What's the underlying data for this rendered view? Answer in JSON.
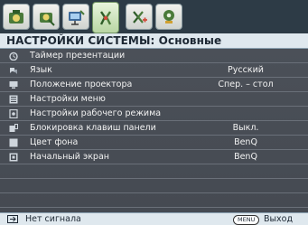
{
  "tabs": [
    {
      "icon": "picture-icon"
    },
    {
      "icon": "picture-advanced-icon"
    },
    {
      "icon": "display-icon"
    },
    {
      "icon": "system-setup-icon",
      "active": true
    },
    {
      "icon": "system-advanced-icon"
    },
    {
      "icon": "information-icon"
    }
  ],
  "title": "НАСТРОЙКИ СИСТЕМЫ: Основные",
  "menu": [
    {
      "label": "Таймер презентации",
      "value": "",
      "icon": "timer-icon"
    },
    {
      "label": "Язык",
      "value": "Русский",
      "icon": "language-icon"
    },
    {
      "label": "Положение проектора",
      "value": "Спер. – стол",
      "icon": "projector-position-icon"
    },
    {
      "label": "Настройки меню",
      "value": "",
      "icon": "menu-settings-icon"
    },
    {
      "label": "Настройки рабочего режима",
      "value": "",
      "icon": "operation-settings-icon"
    },
    {
      "label": "Блокировка клавиш панели",
      "value": "Выкл.",
      "icon": "key-lock-icon"
    },
    {
      "label": "Цвет фона",
      "value": "BenQ",
      "icon": "background-color-icon"
    },
    {
      "label": "Начальный экран",
      "value": "BenQ",
      "icon": "splash-screen-icon"
    },
    {
      "label": "",
      "value": ""
    },
    {
      "label": "",
      "value": ""
    },
    {
      "label": "",
      "value": ""
    },
    {
      "label": "",
      "value": ""
    }
  ],
  "footer": {
    "signal": "Нет сигнала",
    "menu_key": "MENU",
    "exit": "Выход"
  }
}
